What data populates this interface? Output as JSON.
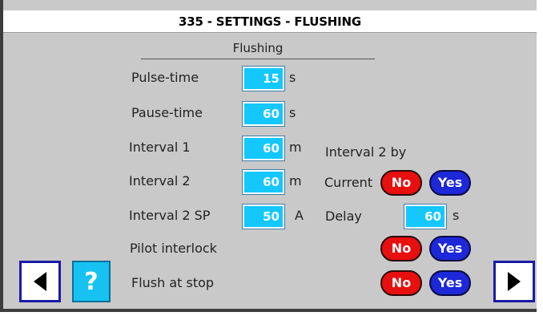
{
  "window": {
    "title": "335 - SETTINGS - FLUSHING"
  },
  "section": {
    "title": "Flushing"
  },
  "fields": [
    {
      "label": "Pulse-time",
      "value": "15",
      "unit": "s"
    },
    {
      "label": "Pause-time",
      "value": "60",
      "unit": "s"
    },
    {
      "label": "Interval 1",
      "value": "60",
      "unit": "m"
    },
    {
      "label": "Interval 2",
      "value": "60",
      "unit": "m"
    },
    {
      "label": "Interval 2 SP",
      "value": "50",
      "unit": "A"
    }
  ],
  "interval2_by": {
    "heading": "Interval 2 by",
    "current_label": "Current",
    "delay_label": "Delay",
    "delay_value": "60",
    "delay_unit": "s"
  },
  "options": {
    "pilot_interlock_label": "Pilot interlock",
    "flush_at_stop_label": "Flush at stop",
    "no_label": "No",
    "yes_label": "Yes"
  },
  "nav": {
    "help_label": "?",
    "prev_icon": "triangle-left-icon",
    "next_icon": "triangle-right-icon"
  },
  "colors": {
    "field_bg": "#14c8ff",
    "no_bg": "#e80f0f",
    "yes_bg": "#1d28d8",
    "nav_border": "#1a1aa8"
  }
}
